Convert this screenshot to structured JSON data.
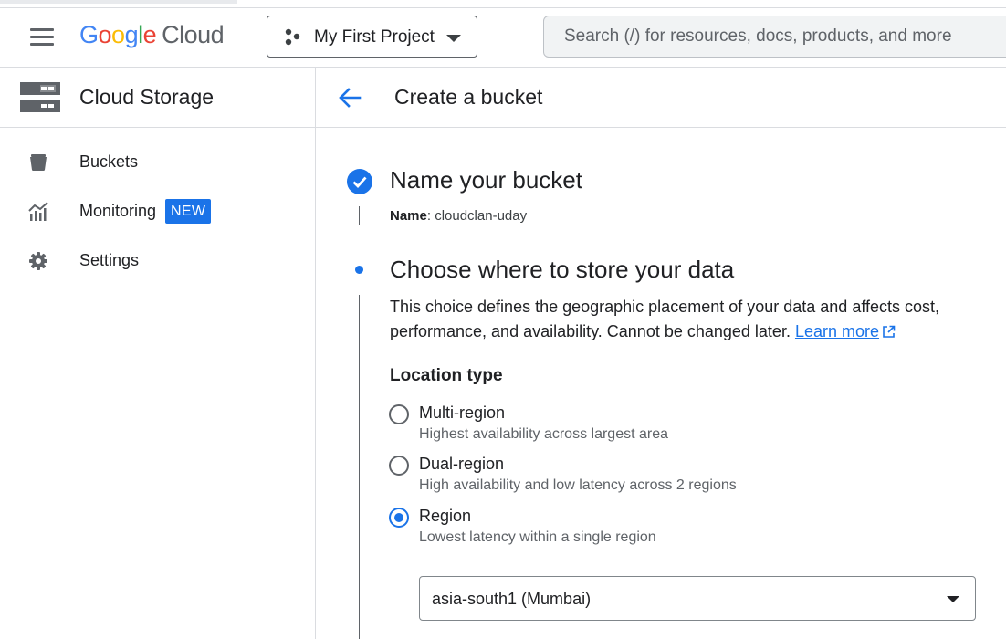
{
  "header": {
    "logo": {
      "google": [
        "G",
        "o",
        "o",
        "g",
        "l",
        "e"
      ],
      "google_colors": [
        "#4285F4",
        "#EA4335",
        "#FBBC05",
        "#4285F4",
        "#34A853",
        "#EA4335"
      ],
      "cloud": "Cloud"
    },
    "project": {
      "label": "My First Project"
    },
    "search": {
      "placeholder": "Search (/) for resources, docs, products, and more"
    }
  },
  "sidebar": {
    "title": "Cloud Storage",
    "items": [
      {
        "label": "Buckets",
        "icon": "bucket-icon"
      },
      {
        "label": "Monitoring",
        "icon": "monitoring-icon",
        "badge": "NEW"
      },
      {
        "label": "Settings",
        "icon": "gear-icon"
      }
    ]
  },
  "main": {
    "title": "Create a bucket",
    "step1": {
      "title": "Name your bucket",
      "name_key": "Name",
      "name_value": ": cloudclan-uday"
    },
    "step2": {
      "title": "Choose where to store your data",
      "desc_line1": "This choice defines the geographic placement of your data and affects cost,",
      "desc_line2": "performance, and availability. Cannot be changed later.",
      "learn_more": "Learn more",
      "location_type_label": "Location type",
      "options": [
        {
          "label": "Multi-region",
          "sub": "Highest availability across largest area",
          "checked": false
        },
        {
          "label": "Dual-region",
          "sub": "High availability and low latency across 2 regions",
          "checked": false
        },
        {
          "label": "Region",
          "sub": "Lowest latency within a single region",
          "checked": true
        }
      ],
      "region_select": "asia-south1 (Mumbai)"
    }
  },
  "colors": {
    "accent": "#1a73e8",
    "text": "#202124",
    "muted": "#5f6368"
  }
}
